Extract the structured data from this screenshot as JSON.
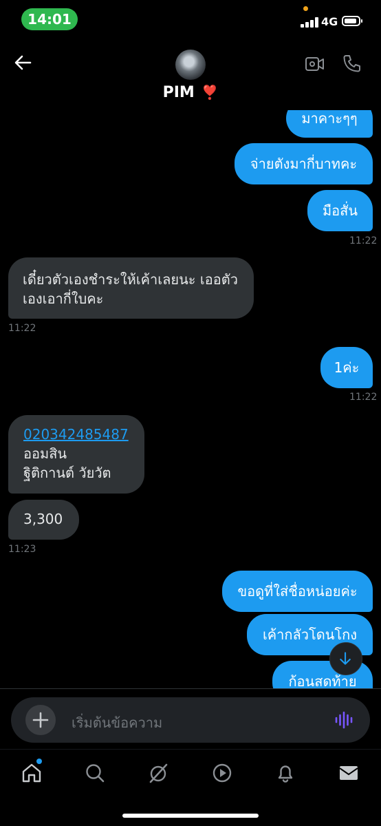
{
  "status_bar": {
    "time": "14:01",
    "network": "4G"
  },
  "header": {
    "contact_name": "PIM",
    "emoji": "❣️"
  },
  "messages": [
    {
      "dir": "out",
      "text": "มาคาะๆๆ"
    },
    {
      "dir": "out",
      "text": "จ่ายตังมากี่บาทคะ"
    },
    {
      "dir": "out",
      "text": "มือสั่น"
    },
    {
      "dir": "meta",
      "text": "11:22"
    },
    {
      "dir": "in",
      "text1": "เดี๋ยวตัวเองชำระให้เค้าเลยนะ เออตัว",
      "text2": "เองเอากี่ใบคะ"
    },
    {
      "dir": "meta",
      "text": "11:22"
    },
    {
      "dir": "out",
      "text": "1ค่ะ"
    },
    {
      "dir": "meta",
      "text": "11:22"
    },
    {
      "dir": "in",
      "link": "020342485487",
      "line2": "ออมสิน",
      "line3": "ฐิติกานต์ วัยวัต"
    },
    {
      "dir": "in",
      "text": "3,300"
    },
    {
      "dir": "meta",
      "text": "11:23"
    },
    {
      "dir": "out",
      "text": "ขอดูที่ใส่ชื่อหน่อยค่ะ"
    },
    {
      "dir": "out",
      "text": "เค้ากลัวโดนโกง"
    },
    {
      "dir": "out",
      "text": "ก้อนสดท้าย"
    }
  ],
  "composer": {
    "placeholder": "เริ่มต้นข้อความ"
  },
  "colors": {
    "accent": "#1d9bf0",
    "incoming": "#2f3336",
    "status_pill": "#2fb84f",
    "mic": "#7856ff"
  },
  "icons": {
    "header": [
      "back-arrow-icon",
      "video-call-icon",
      "phone-call-icon"
    ],
    "nav": [
      "home-icon",
      "search-icon",
      "grok-icon",
      "video-icon",
      "bell-icon",
      "mail-icon"
    ]
  }
}
